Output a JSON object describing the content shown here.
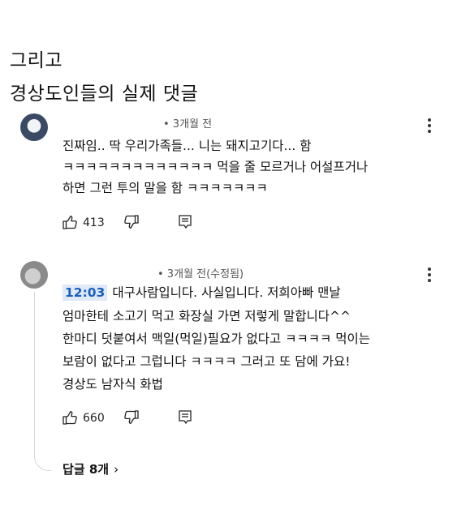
{
  "post": {
    "heading1": "그리고",
    "heading2": "경상도인들의 실제 댓글"
  },
  "comments": [
    {
      "meta": "• 3개월 전",
      "lines": [
        "진짜임.. 딱 우리가족들... 니는 돼지고기다... 함",
        "ㅋㅋㅋㅋㅋㅋㅋㅋㅋㅋㅋㅋㅋ 먹을 줄 모르거나 어설프거나",
        "하면 그런 투의 말을 함 ㅋㅋㅋㅋㅋㅋㅋ"
      ],
      "likes": "413"
    },
    {
      "meta": "• 3개월 전(수정됨)",
      "timestamp": "12:03",
      "lines": [
        "대구사람입니다. 사실입니다. 저희아빠 맨날",
        "엄마한테 소고기 먹고 화장실 가면 저렇게 말합니다^^",
        "한마디 덧붙여서 맥일(먹일)필요가 없다고 ㅋㅋㅋㅋ 먹이는",
        "보람이 없다고 그럽니다 ㅋㅋㅋㅋ 그러고 또 담에 가요!",
        "경상도 남자식 화법"
      ],
      "likes": "660",
      "replies": "답글 8개",
      "replies_chevron": "›"
    }
  ],
  "icons": [
    "thumbs-up-icon",
    "thumbs-down-icon",
    "reply-icon",
    "more-options-icon"
  ]
}
